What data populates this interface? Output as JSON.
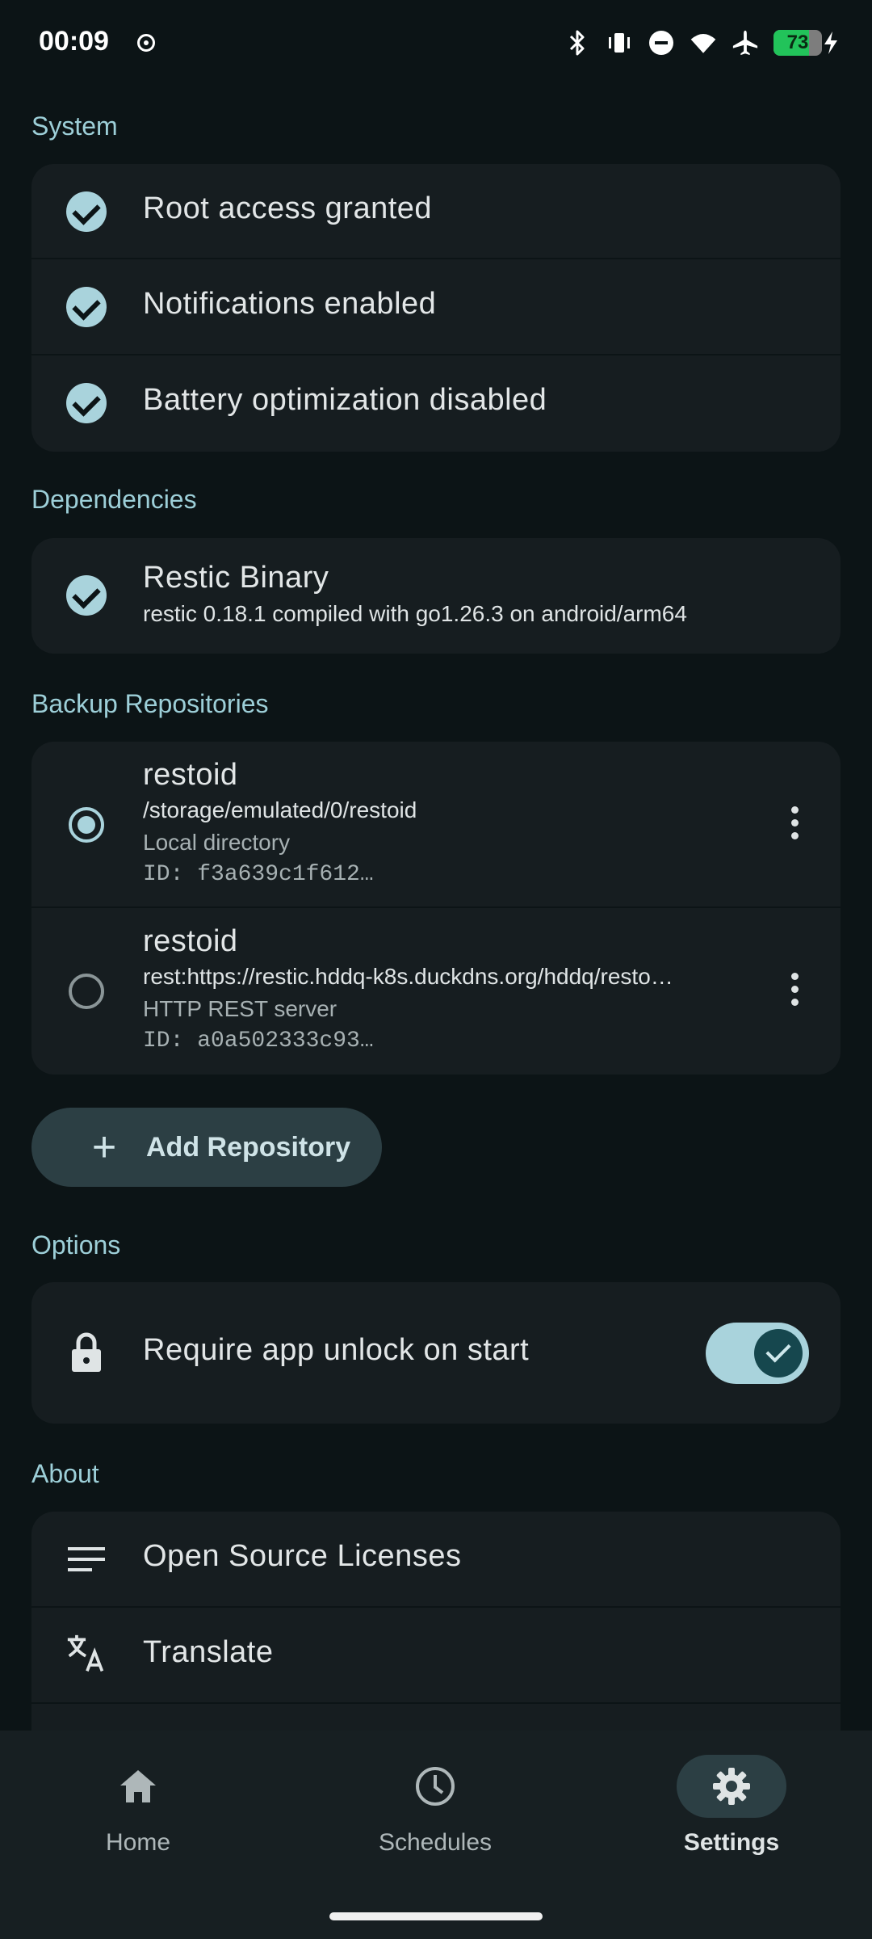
{
  "status_bar": {
    "time": "00:09",
    "battery_level": 73,
    "battery_text": "73",
    "icons": [
      "record-icon",
      "bluetooth-icon",
      "vibrate-icon",
      "do-not-disturb-icon",
      "wifi-icon",
      "airplane-icon",
      "battery-icon",
      "charging-icon"
    ]
  },
  "sections": {
    "system": "System",
    "dependencies": "Dependencies",
    "repositories": "Backup Repositories",
    "options": "Options",
    "about": "About"
  },
  "system_items": [
    {
      "label": "Root access granted",
      "icon": "check-circle-icon"
    },
    {
      "label": "Notifications enabled",
      "icon": "check-circle-icon"
    },
    {
      "label": "Battery optimization disabled",
      "icon": "check-circle-icon"
    }
  ],
  "dependency": {
    "title": "Restic Binary",
    "subtitle": "restic 0.18.1 compiled with go1.26.3 on android/arm64"
  },
  "repositories": [
    {
      "name": "restoid",
      "path": "/storage/emulated/0/restoid",
      "type": "Local directory",
      "id": "ID: f3a639c1f612…",
      "selected": true
    },
    {
      "name": "restoid",
      "path": "rest:https://restic.hddq-k8s.duckdns.org/hddq/resto…",
      "type": "HTTP REST server",
      "id": "ID: a0a502333c93…",
      "selected": false
    }
  ],
  "add_repository_label": "Add Repository",
  "options": {
    "require_unlock_label": "Require app unlock on start",
    "require_unlock_enabled": true
  },
  "about_items": [
    {
      "label": "Open Source Licenses",
      "icon": "list-icon"
    },
    {
      "label": "Translate",
      "icon": "translate-icon"
    }
  ],
  "bottom_nav": [
    {
      "label": "Home",
      "icon": "home-icon",
      "active": false
    },
    {
      "label": "Schedules",
      "icon": "clock-icon",
      "active": false
    },
    {
      "label": "Settings",
      "icon": "gear-icon",
      "active": true
    }
  ],
  "colors": {
    "background": "#0c1416",
    "card": "#161d20",
    "accent": "#a9d3dc",
    "section_title": "#9dcfd8",
    "battery_fill": "#22c35a"
  }
}
